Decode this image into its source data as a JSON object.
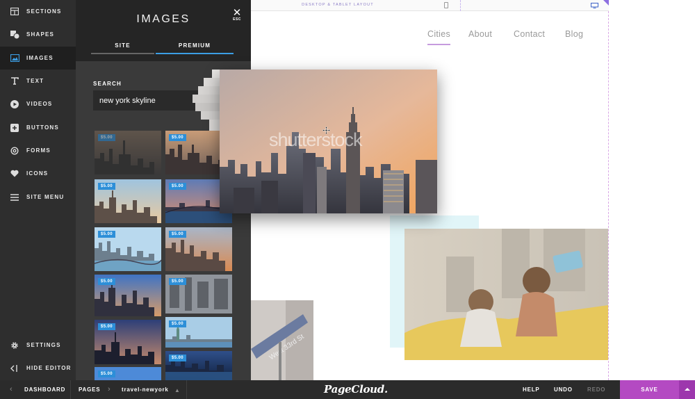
{
  "rail": {
    "items": [
      {
        "label": "SECTIONS",
        "icon": "sections-icon"
      },
      {
        "label": "SHAPES",
        "icon": "shapes-icon"
      },
      {
        "label": "IMAGES",
        "icon": "images-icon",
        "active": true
      },
      {
        "label": "TEXT",
        "icon": "text-icon"
      },
      {
        "label": "VIDEOS",
        "icon": "play-icon"
      },
      {
        "label": "BUTTONS",
        "icon": "button-plus-icon"
      },
      {
        "label": "FORMS",
        "icon": "at-icon"
      },
      {
        "label": "ICONS",
        "icon": "heart-icon"
      },
      {
        "label": "SITE MENU",
        "icon": "hamburger-icon"
      }
    ],
    "settings_label": "SETTINGS",
    "hide_editor_label": "HIDE EDITOR"
  },
  "panel": {
    "title": "IMAGES",
    "esc_label": "ESC",
    "tabs": [
      {
        "label": "SITE"
      },
      {
        "label": "PREMIUM",
        "active": true
      }
    ],
    "search_label": "SEARCH",
    "search_value": "new york skyline",
    "price_label": "$5.00"
  },
  "topbar": {
    "layout_label": "DESKTOP & TABLET LAYOUT"
  },
  "site": {
    "nav": [
      "Cities",
      "About",
      "Contact",
      "Blog"
    ],
    "watermark": "shutterstock"
  },
  "bottombar": {
    "dashboard": "DASHBOARD",
    "pages": "PAGES",
    "current_page": "travel-newyork",
    "logo": "PageCloud.",
    "help": "HELP",
    "undo": "UNDO",
    "redo": "REDO",
    "save": "SAVE"
  },
  "colors": {
    "accent": "#b44ac2",
    "price_badge": "#2d8fd8",
    "tab_active": "#3c9ee5",
    "nav_active_underline": "#c69bde"
  }
}
